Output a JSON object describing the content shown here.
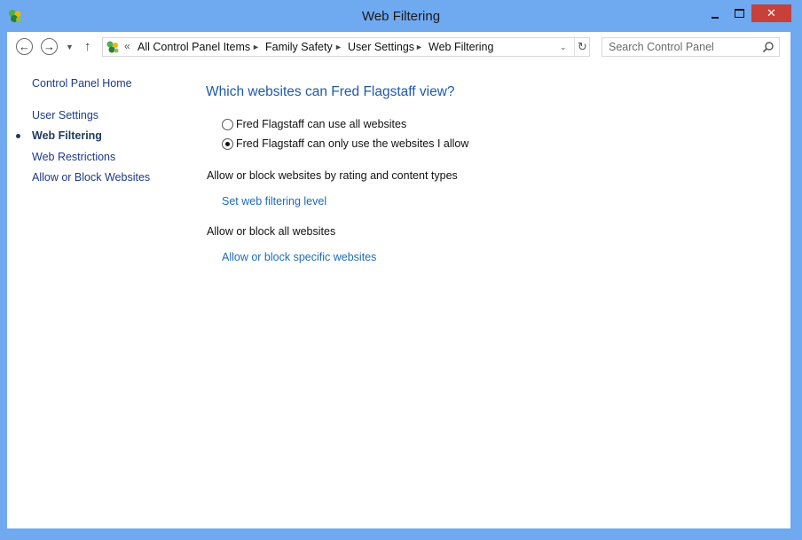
{
  "window": {
    "title": "Web Filtering",
    "close_glyph": "✕",
    "accent_color": "#6fa9f0",
    "close_color": "#c7403a"
  },
  "icons": {
    "app": "family-safety-icon",
    "back": "back-arrow-icon",
    "forward": "forward-arrow-icon",
    "up": "up-arrow-icon",
    "refresh": "refresh-icon",
    "search": "search-icon"
  },
  "nav": {
    "back_glyph": "←",
    "forward_glyph": "→",
    "recent_glyph": "▼",
    "up_glyph": "↑",
    "refresh_glyph": "↻"
  },
  "address": {
    "overflow": "«",
    "separator": "►",
    "dropdown": "⌄",
    "crumbs": [
      "All Control Panel Items",
      "Family Safety",
      "User Settings",
      "Web Filtering"
    ]
  },
  "search": {
    "placeholder": "Search Control Panel"
  },
  "sidebar": {
    "home": "Control Panel Home",
    "items": [
      {
        "label": "User Settings",
        "current": false
      },
      {
        "label": "Web Filtering",
        "current": true
      },
      {
        "label": "Web Restrictions",
        "current": false
      },
      {
        "label": "Allow or Block Websites",
        "current": false
      }
    ]
  },
  "main": {
    "heading": "Which websites can Fred Flagstaff view?",
    "options": [
      {
        "label": "Fred Flagstaff can use all websites",
        "checked": false
      },
      {
        "label": "Fred Flagstaff can only use the websites I allow",
        "checked": true
      }
    ],
    "sections": [
      {
        "label": "Allow or block websites by rating and content types",
        "link": "Set web filtering level"
      },
      {
        "label": "Allow or block all websites",
        "link": "Allow or block specific websites"
      }
    ]
  }
}
